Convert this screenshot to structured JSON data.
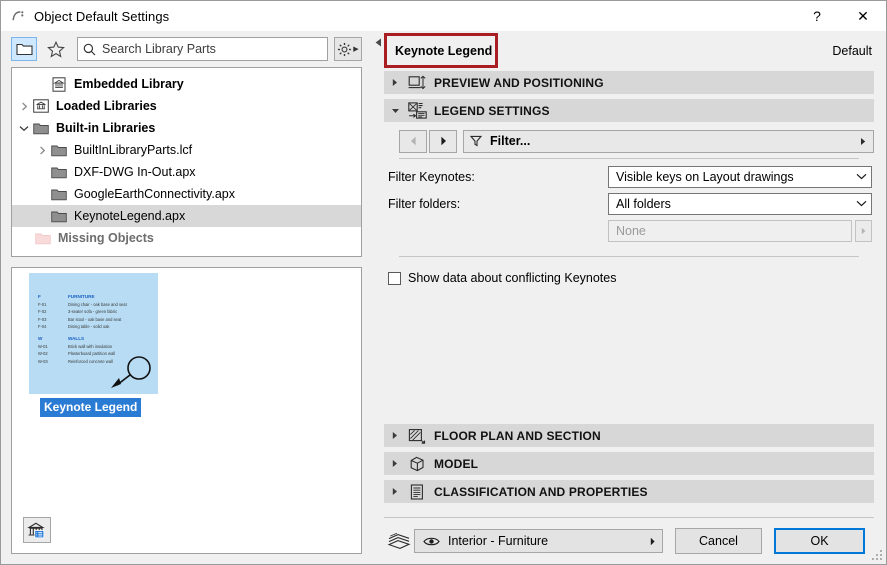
{
  "window": {
    "title": "Object Default Settings",
    "app_icon": "archicad-icon",
    "help_label": "?",
    "close_label": "✕"
  },
  "left_panel": {
    "toolbar": {
      "folder_button": "folder-view-icon",
      "favorites_button": "star-icon",
      "settings_button": "gear-icon",
      "search": {
        "placeholder": "Search Library Parts",
        "value": "",
        "icon": "search-icon"
      }
    },
    "tree": [
      {
        "label": "Embedded Library",
        "icon": "embedded-library-icon",
        "indent": 1,
        "arrow": "none",
        "bold": true,
        "selected": false,
        "muted": false
      },
      {
        "label": "Loaded Libraries",
        "icon": "loaded-library-icon",
        "indent": 0,
        "arrow": "collapsed",
        "bold": true,
        "selected": false,
        "muted": false
      },
      {
        "label": "Built-in Libraries",
        "icon": "folder-icon",
        "indent": 0,
        "arrow": "expanded",
        "bold": true,
        "selected": false,
        "muted": false
      },
      {
        "label": "BuiltInLibraryParts.lcf",
        "icon": "folder-icon",
        "indent": 1,
        "arrow": "collapsed",
        "bold": false,
        "selected": false,
        "muted": false
      },
      {
        "label": "DXF-DWG In-Out.apx",
        "icon": "folder-icon",
        "indent": 2,
        "arrow": "none",
        "bold": false,
        "selected": false,
        "muted": false
      },
      {
        "label": "GoogleEarthConnectivity.apx",
        "icon": "folder-icon",
        "indent": 2,
        "arrow": "none",
        "bold": false,
        "selected": false,
        "muted": false
      },
      {
        "label": "KeynoteLegend.apx",
        "icon": "folder-icon",
        "indent": 2,
        "arrow": "none",
        "bold": false,
        "selected": true,
        "muted": false
      },
      {
        "label": "Missing Objects",
        "icon": "missing-folder-icon",
        "indent": 1,
        "arrow": "none",
        "bold": true,
        "selected": false,
        "muted": true
      }
    ],
    "preview": {
      "caption": "Keynote Legend",
      "background_color": "#b7dcf3",
      "rows": [
        {
          "key": "F",
          "text": "FURNITURE",
          "heading": true
        },
        {
          "key": "F-01",
          "text": "Dining chair - oak base and seat",
          "heading": false
        },
        {
          "key": "F-02",
          "text": "3-seater sofa -  green fabric",
          "heading": false
        },
        {
          "key": "F-03",
          "text": "Bar stool - oak base and seat",
          "heading": false
        },
        {
          "key": "F-04",
          "text": "Dining table - solid oak",
          "heading": false
        },
        {
          "key": "W",
          "text": "WALLS",
          "heading": true
        },
        {
          "key": "W-01",
          "text": "Brick wall with insulation",
          "heading": false
        },
        {
          "key": "W-02",
          "text": "Plasterboard partition wall",
          "heading": false
        },
        {
          "key": "W-03",
          "text": "Reinforced concrete wall",
          "heading": false
        }
      ]
    },
    "library_manager_button": "library-manager-icon"
  },
  "splitter": {
    "handle_icon": "collapse-left-icon"
  },
  "right_panel": {
    "object_name": "Keynote Legend",
    "object_name_highlight_color": "#a81e22",
    "default_label": "Default",
    "sections": [
      {
        "id": "preview-and-positioning",
        "title": "PREVIEW AND POSITIONING",
        "icon": "preview-positioning-icon",
        "expanded": false
      },
      {
        "id": "legend-settings",
        "title": "LEGEND SETTINGS",
        "icon": "legend-settings-icon",
        "expanded": true
      },
      {
        "id": "floor-plan-and-section",
        "title": "FLOOR PLAN AND SECTION",
        "icon": "floor-plan-icon",
        "expanded": false
      },
      {
        "id": "model",
        "title": "MODEL",
        "icon": "model-cube-icon",
        "expanded": false
      },
      {
        "id": "classification-and-properties",
        "title": "CLASSIFICATION AND PROPERTIES",
        "icon": "classification-icon",
        "expanded": false
      }
    ],
    "legend_settings": {
      "filter_toolbar": {
        "back_button": "arrow-left-icon",
        "forward_button": "arrow-right-icon",
        "filter_icon": "funnel-icon",
        "filter_label": "Filter...",
        "expand_arrow": "arrow-right-icon"
      },
      "filter_keynotes": {
        "label": "Filter Keynotes:",
        "value": "Visible keys on Layout drawings"
      },
      "filter_folders": {
        "label": "Filter folders:",
        "value": "All folders"
      },
      "folder_selection": {
        "value": "None",
        "disabled": true
      },
      "conflicting_keynotes": {
        "label": "Show data about conflicting Keynotes",
        "checked": false
      }
    }
  },
  "footer": {
    "layer_icon": "layers-icon",
    "layer_eye_icon": "eye-icon",
    "layer_value": "Interior - Furniture",
    "layer_arrow": "▸",
    "cancel_label": "Cancel",
    "ok_label": "OK",
    "accent_color": "#0078d7"
  }
}
